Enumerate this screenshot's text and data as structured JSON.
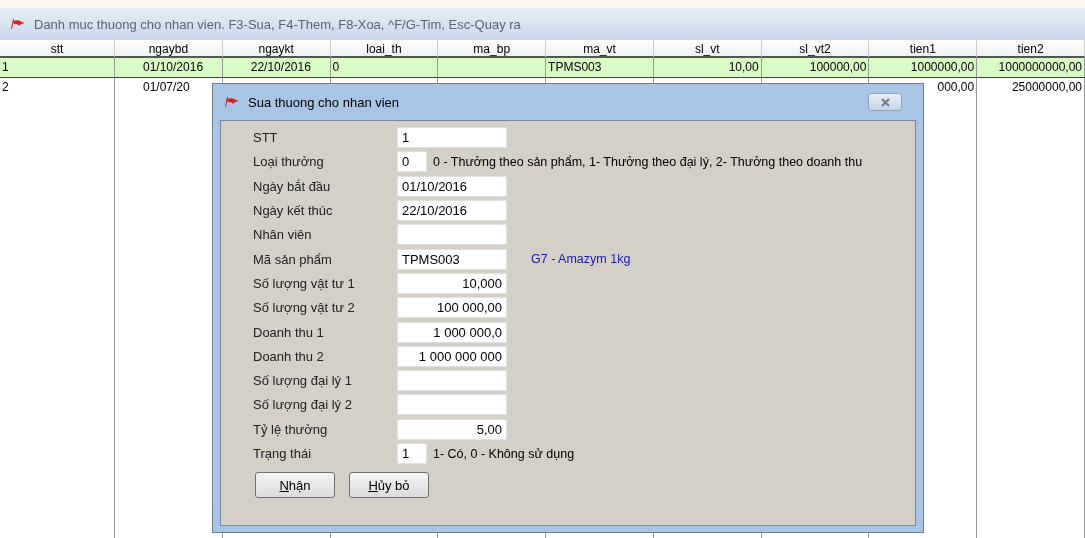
{
  "window": {
    "title": "Danh muc thuong cho nhan vien. F3-Sua, F4-Them, F8-Xoa, ^F/G-Tim, Esc-Quay ra"
  },
  "table": {
    "columns": [
      {
        "label": "stt",
        "kind": "text"
      },
      {
        "label": "ngaybd",
        "kind": "date"
      },
      {
        "label": "ngaykt",
        "kind": "date"
      },
      {
        "label": "loai_th",
        "kind": "text"
      },
      {
        "label": "ma_bp",
        "kind": "text"
      },
      {
        "label": "ma_vt",
        "kind": "text"
      },
      {
        "label": "sl_vt",
        "kind": "number"
      },
      {
        "label": "sl_vt2",
        "kind": "number"
      },
      {
        "label": "tien1",
        "kind": "number"
      },
      {
        "label": "tien2",
        "kind": "number"
      }
    ],
    "rows": [
      {
        "selected": true,
        "cells": [
          "1",
          "01/10/2016",
          "22/10/2016",
          "0",
          "",
          "TPMS003",
          "10,00",
          "100000,00",
          "1000000,00",
          "1000000000,00"
        ]
      },
      {
        "selected": false,
        "cells": [
          "2",
          "01/07/20",
          "",
          "",
          "",
          "",
          "",
          "",
          "000,00",
          "25000000,00"
        ]
      }
    ]
  },
  "dialog": {
    "title": "Sua thuong cho nhan vien",
    "fields": [
      {
        "label": "STT",
        "value": "1",
        "kind": "text"
      },
      {
        "label": "Loại thưởng",
        "value": "0",
        "kind": "short",
        "note": {
          "text": "0 - Thưởng theo sản phẩm, 1- Thưởng theo đại lý, 2- Thưởng theo doanh thu",
          "color": "#000000"
        }
      },
      {
        "label": "Ngày bắt đầu",
        "value": "01/10/2016",
        "kind": "text"
      },
      {
        "label": "Ngày kết thúc",
        "value": "22/10/2016",
        "kind": "text"
      },
      {
        "label": "Nhân viên",
        "kind": "text"
      },
      {
        "label": "Mã sản phẩm",
        "value": "TPMS003",
        "kind": "text",
        "note": {
          "text": "G7 - Amazym 1kg",
          "color": "#1a1ab8"
        }
      },
      {
        "label": "Số lượng vật tư 1",
        "value": "10,000",
        "kind": "number"
      },
      {
        "label": "Số lượng vật tư 2",
        "value": "100 000,00",
        "kind": "number"
      },
      {
        "label": "Doanh thu 1",
        "value": "1 000 000,0",
        "kind": "number"
      },
      {
        "label": "Doanh thu 2",
        "value": "1 000 000 000",
        "kind": "number"
      },
      {
        "label": "Số lượng đại lý 1",
        "kind": "number"
      },
      {
        "label": "Số lượng đại lý 2",
        "kind": "number"
      },
      {
        "label": "Tỷ lệ thưởng",
        "value": "5,00",
        "kind": "number"
      },
      {
        "label": "Trạng thái",
        "value": "1",
        "kind": "short",
        "note": {
          "text": "1- Có, 0 - Không sử dụng",
          "color": "#000000"
        }
      }
    ],
    "buttons": [
      {
        "label": "Nhận",
        "underline_first": true
      },
      {
        "label": "Hủy bỏ",
        "underline_first": true
      }
    ]
  }
}
